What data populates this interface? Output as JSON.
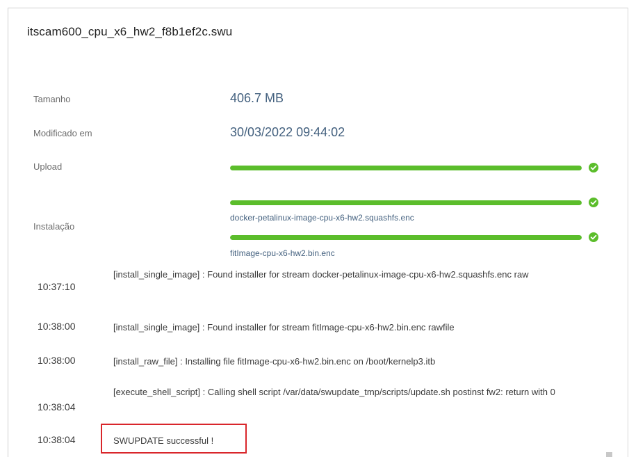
{
  "file": {
    "name": "itscam600_cpu_x6_hw2_f8b1ef2c.swu"
  },
  "details": {
    "size_label": "Tamanho",
    "size_value": "406.7 MB",
    "modified_label": "Modificado em",
    "modified_value": "30/03/2022 09:44:02",
    "upload_label": "Upload",
    "upload_progress": 1.0,
    "install_label": "Instalação",
    "install_items": [
      {
        "progress": 1.0,
        "caption": "docker-petalinux-image-cpu-x6-hw2.squashfs.enc"
      },
      {
        "progress": 1.0,
        "caption": "fitImage-cpu-x6-hw2.bin.enc"
      }
    ]
  },
  "log": [
    {
      "time": "10:37:10",
      "message": "[install_single_image] : Found installer for stream docker-petalinux-image-cpu-x6-hw2.squashfs.enc raw"
    },
    {
      "time": "10:38:00",
      "message": "[install_single_image] : Found installer for stream fitImage-cpu-x6-hw2.bin.enc rawfile"
    },
    {
      "time": "10:38:00",
      "message": "[install_raw_file] : Installing file fitImage-cpu-x6-hw2.bin.enc on /boot/kernelp3.itb"
    },
    {
      "time": "10:38:04",
      "message": "[execute_shell_script] : Calling shell script /var/data/swupdate_tmp/scripts/update.sh postinst fw2: return with 0"
    },
    {
      "time": "10:38:04",
      "message": "SWUPDATE successful !"
    }
  ],
  "colors": {
    "progress": "#5bbd2b",
    "value_text": "#44617f",
    "highlight": "#d9262b"
  }
}
